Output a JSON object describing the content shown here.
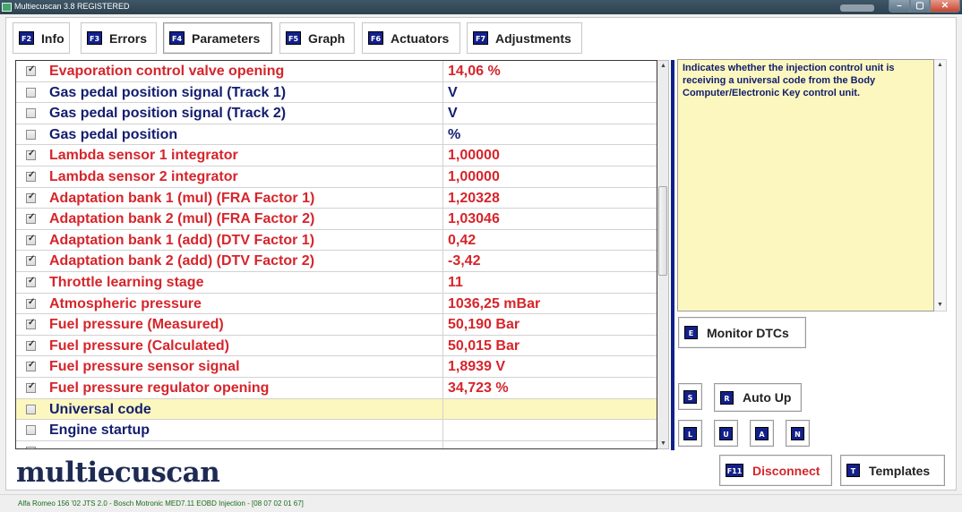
{
  "window": {
    "title": "Multiecuscan 3.8 REGISTERED",
    "controls": {
      "minimize": "–",
      "maximize": "▢",
      "close": "✕"
    }
  },
  "tabs": [
    {
      "key": "F2",
      "label": "Info"
    },
    {
      "key": "F3",
      "label": "Errors"
    },
    {
      "key": "F4",
      "label": "Parameters",
      "active": true
    },
    {
      "key": "F5",
      "label": "Graph"
    },
    {
      "key": "F6",
      "label": "Actuators"
    },
    {
      "key": "F7",
      "label": "Adjustments"
    }
  ],
  "parameters": [
    {
      "checked": true,
      "name": "Evaporation control valve opening",
      "value": "14,06 %",
      "color": "red"
    },
    {
      "checked": false,
      "name": "Gas pedal position signal (Track 1)",
      "value": "V",
      "color": "blue"
    },
    {
      "checked": false,
      "name": "Gas pedal position signal (Track 2)",
      "value": "V",
      "color": "blue"
    },
    {
      "checked": false,
      "name": "Gas pedal position",
      "value": "%",
      "color": "blue"
    },
    {
      "checked": true,
      "name": "Lambda sensor 1 integrator",
      "value": "1,00000",
      "color": "red"
    },
    {
      "checked": true,
      "name": "Lambda sensor 2 integrator",
      "value": "1,00000",
      "color": "red"
    },
    {
      "checked": true,
      "name": "Adaptation bank 1 (mul) (FRA Factor 1)",
      "value": "1,20328",
      "color": "red"
    },
    {
      "checked": true,
      "name": "Adaptation bank 2 (mul) (FRA Factor 2)",
      "value": "1,03046",
      "color": "red"
    },
    {
      "checked": true,
      "name": "Adaptation bank 1 (add) (DTV Factor 1)",
      "value": "0,42",
      "color": "red"
    },
    {
      "checked": true,
      "name": "Adaptation bank 2 (add) (DTV Factor 2)",
      "value": "-3,42",
      "color": "red"
    },
    {
      "checked": true,
      "name": "Throttle learning stage",
      "value": "11",
      "color": "red"
    },
    {
      "checked": true,
      "name": "Atmospheric pressure",
      "value": "1036,25 mBar",
      "color": "red"
    },
    {
      "checked": true,
      "name": "Fuel pressure (Measured)",
      "value": "50,190 Bar",
      "color": "red"
    },
    {
      "checked": true,
      "name": "Fuel pressure (Calculated)",
      "value": "50,015 Bar",
      "color": "red"
    },
    {
      "checked": true,
      "name": "Fuel pressure sensor signal",
      "value": "1,8939 V",
      "color": "red"
    },
    {
      "checked": true,
      "name": "Fuel pressure regulator opening",
      "value": "34,723 %",
      "color": "red"
    },
    {
      "checked": false,
      "name": "Universal code",
      "value": "",
      "color": "blue",
      "selected": true
    },
    {
      "checked": false,
      "name": "Engine startup",
      "value": "",
      "color": "blue"
    },
    {
      "checked": false,
      "name": "",
      "value": "",
      "color": "blue"
    }
  ],
  "description": "Indicates whether the injection control unit is receiving a universal code from the Body Computer/Electronic Key control unit.",
  "buttons": {
    "monitor_dtcs": {
      "key": "E",
      "label": "Monitor DTCs"
    },
    "s": {
      "key": "S"
    },
    "auto_up": {
      "key": "R",
      "label": "Auto Up"
    },
    "l": {
      "key": "L"
    },
    "u": {
      "key": "U"
    },
    "a": {
      "key": "A"
    },
    "n": {
      "key": "N"
    },
    "disconnect": {
      "key": "F11",
      "label": "Disconnect"
    },
    "templates": {
      "key": "T",
      "label": "Templates"
    }
  },
  "logo": "multiecuscan",
  "status": "Alfa Romeo 156 '02 JTS 2.0 - Bosch Motronic MED7.11 EOBD Injection - [08 07 02 01 67]",
  "colors": {
    "red": "#d6252b",
    "blue": "#121d6e",
    "key_bg": "#12208a",
    "highlight": "#fbf7be"
  }
}
